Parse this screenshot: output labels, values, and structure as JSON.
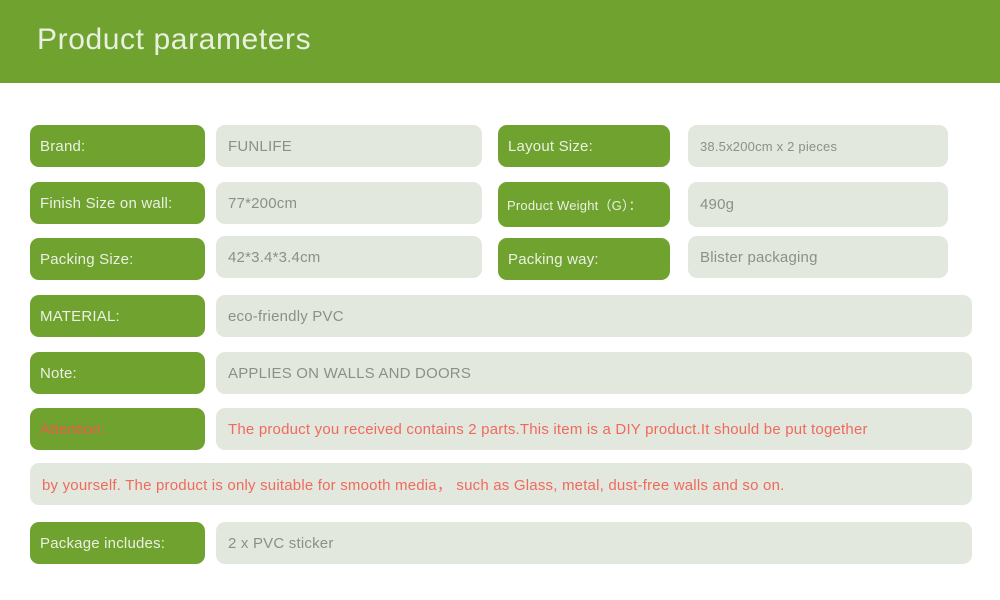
{
  "header": {
    "title": "Product parameters"
  },
  "colors": {
    "green": "#6fa22e",
    "value_bg": "#e3e8de",
    "label_text": "#eaf1e2",
    "value_text": "#8c8f8a",
    "warning_text": "#ef6a5c"
  },
  "rows": {
    "brand": {
      "label": "Brand:",
      "value": "FUNLIFE"
    },
    "layout_size": {
      "label": "Layout Size:",
      "value": "38.5x200cm x 2 pieces"
    },
    "finish_size": {
      "label": "Finish Size on wall:",
      "value": "77*200cm"
    },
    "product_weight": {
      "label": "Product Weight（G）：",
      "value": "490g"
    },
    "packing_size": {
      "label": "Packing Size:",
      "value": "42*3.4*3.4cm"
    },
    "packing_way": {
      "label": "Packing way:",
      "value": "Blister packaging"
    },
    "material": {
      "label": "MATERIAL:",
      "value": "eco-friendly PVC"
    },
    "note": {
      "label": "Note:",
      "value": "APPLIES ON WALLS AND DOORS"
    },
    "attention": {
      "label": "Attention:",
      "value_line1": "The product you received contains 2 parts.This item is a DIY product.It should be put together",
      "value_line2": "by yourself. The product is only suitable for smooth media，  such as Glass, metal, dust-free walls and so on."
    },
    "package_includes": {
      "label": "Package includes:",
      "value": "2 x PVC sticker"
    }
  }
}
